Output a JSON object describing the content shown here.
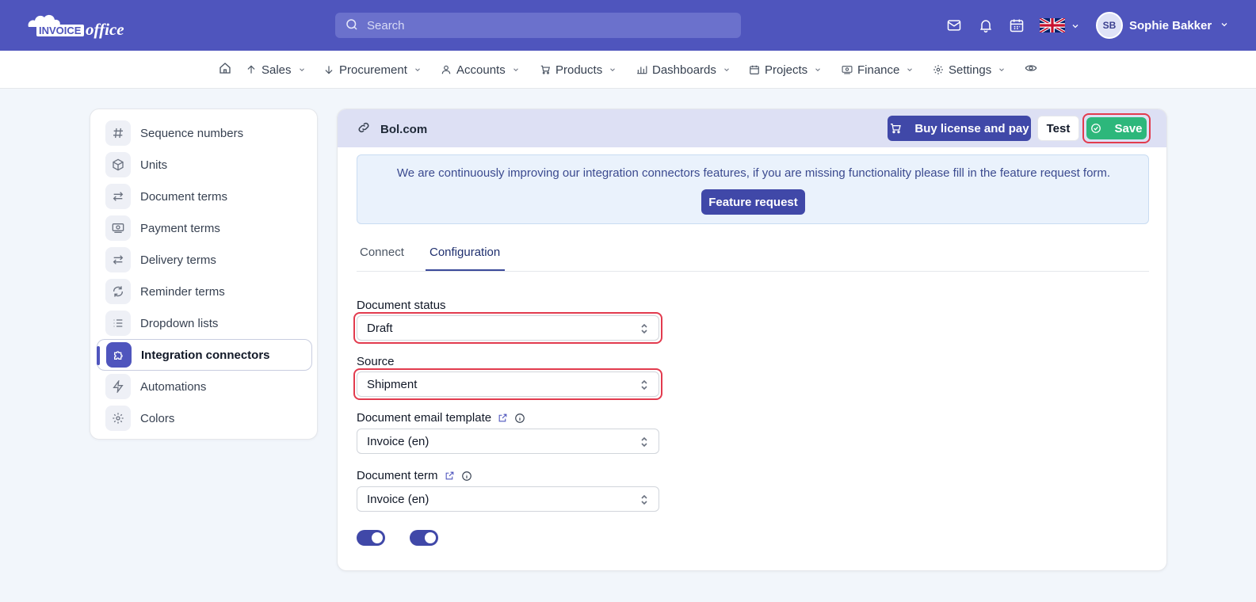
{
  "header": {
    "logo_text": "INVOICEoffice",
    "search_placeholder": "Search",
    "user": {
      "initials": "SB",
      "name": "Sophie Bakker"
    },
    "icons": [
      "mail-icon",
      "bell-icon",
      "calendar-icon",
      "uk-flag-icon"
    ]
  },
  "nav": {
    "items": [
      {
        "label": "",
        "icon": "home-icon"
      },
      {
        "label": "Sales",
        "icon": "arrow-up-icon"
      },
      {
        "label": "Procurement",
        "icon": "arrow-down-icon"
      },
      {
        "label": "Accounts",
        "icon": "user-icon"
      },
      {
        "label": "Products",
        "icon": "cart-icon"
      },
      {
        "label": "Dashboards",
        "icon": "bar-chart-icon"
      },
      {
        "label": "Projects",
        "icon": "calendar-icon"
      },
      {
        "label": "Finance",
        "icon": "money-icon"
      },
      {
        "label": "Settings",
        "icon": "gear-icon"
      },
      {
        "label": "",
        "icon": "eye-icon"
      }
    ]
  },
  "sidebar": {
    "items": [
      {
        "label": "Sequence numbers",
        "icon": "hash-icon"
      },
      {
        "label": "Units",
        "icon": "cube-icon"
      },
      {
        "label": "Document terms",
        "icon": "arrows-swap-icon"
      },
      {
        "label": "Payment terms",
        "icon": "banknote-icon"
      },
      {
        "label": "Delivery terms",
        "icon": "arrows-swap-icon"
      },
      {
        "label": "Reminder terms",
        "icon": "refresh-icon"
      },
      {
        "label": "Dropdown lists",
        "icon": "list-icon"
      },
      {
        "label": "Integration connectors",
        "icon": "puzzle-icon",
        "active": true
      },
      {
        "label": "Automations",
        "icon": "bolt-icon"
      },
      {
        "label": "Colors",
        "icon": "gear-icon"
      }
    ]
  },
  "panel": {
    "title": "Bol.com",
    "buttons": {
      "buy": "Buy license and pay",
      "test": "Test",
      "save": "Save"
    },
    "info": {
      "text": "We are continuously improving our integration connectors features, if you are missing functionality please fill in the feature request form.",
      "button": "Feature request"
    },
    "tabs": [
      {
        "label": "Connect",
        "active": false
      },
      {
        "label": "Configuration",
        "active": true
      }
    ],
    "fields": {
      "document_status": {
        "label": "Document status",
        "value": "Draft"
      },
      "source": {
        "label": "Source",
        "value": "Shipment"
      },
      "email_template": {
        "label": "Document email template",
        "value": "Invoice (en)"
      },
      "document_term": {
        "label": "Document term",
        "value": "Invoice (en)"
      }
    },
    "toggles": [
      true,
      true
    ]
  },
  "colors": {
    "brand": "#4f55bd",
    "save": "#2db77b",
    "highlight": "#e23b4e"
  }
}
